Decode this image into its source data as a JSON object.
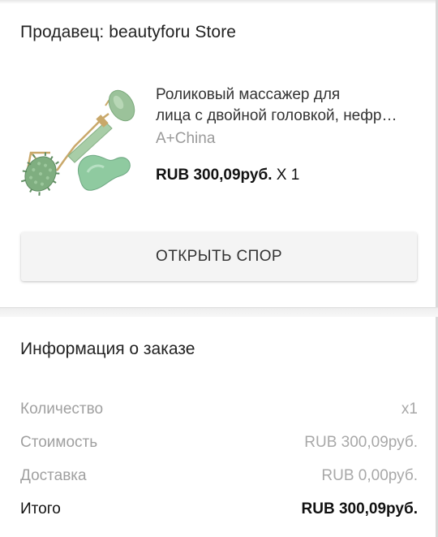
{
  "seller": {
    "label": "Продавец: beautyforu Store"
  },
  "product": {
    "title_line1": "Роликовый массажер для",
    "title_line2": "лица с двойной головкой, нефр…",
    "variant": "A+China",
    "price": "RUB 300,09руб.",
    "quantity": "X 1",
    "image_icon": "jade-roller-image"
  },
  "dispute_button": {
    "label": "ОТКРЫТЬ СПОР"
  },
  "order_info": {
    "title": "Информация о заказе",
    "rows": [
      {
        "label": "Количество",
        "value": "x1"
      },
      {
        "label": "Стоимость",
        "value": "RUB 300,09руб."
      },
      {
        "label": "Доставка",
        "value": "RUB 0,00руб."
      },
      {
        "label": "Итого",
        "value": "RUB 300,09руб."
      }
    ]
  },
  "colors": {
    "jade": "#9bc29a",
    "jade_dark": "#6f9a72",
    "gold": "#c9a86a",
    "button_bg": "#f4f4f4",
    "muted_text": "#a0a0a0"
  }
}
